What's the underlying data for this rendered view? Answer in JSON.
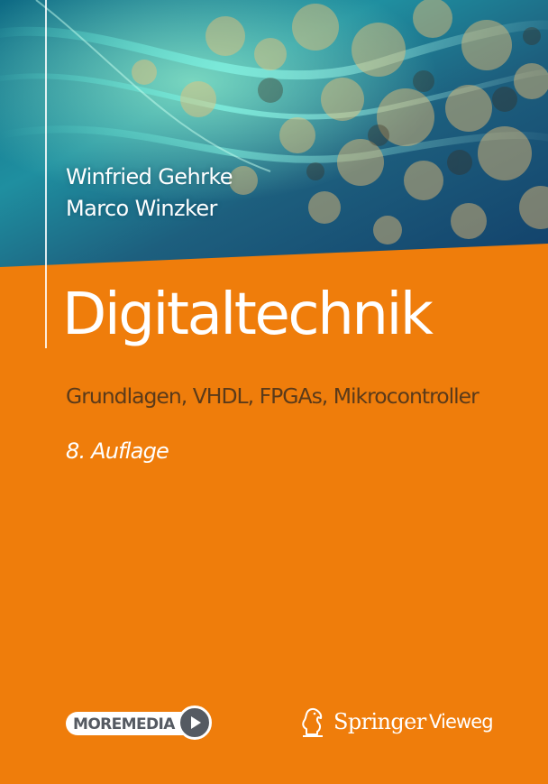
{
  "cover": {
    "authors": [
      "Winfried Gehrke",
      "Marco Winzker"
    ],
    "title": "Digitaltechnik",
    "subtitle": "Grundlagen, VHDL, FPGAs, Mikrocontroller",
    "edition": "8. Auflage",
    "badge_label": "MOREMEDIA",
    "publisher_name": "Springer",
    "publisher_imprint": "Vieweg",
    "colors": {
      "background": "#ef7d0b",
      "banner_dark": "#1a5a78",
      "banner_teal": "#2aa7a8",
      "subtitle_text": "#5a3a1a",
      "badge_grey": "#555a62",
      "text_white": "#ffffff"
    },
    "icons": [
      "play-icon",
      "springer-horse-icon"
    ]
  }
}
